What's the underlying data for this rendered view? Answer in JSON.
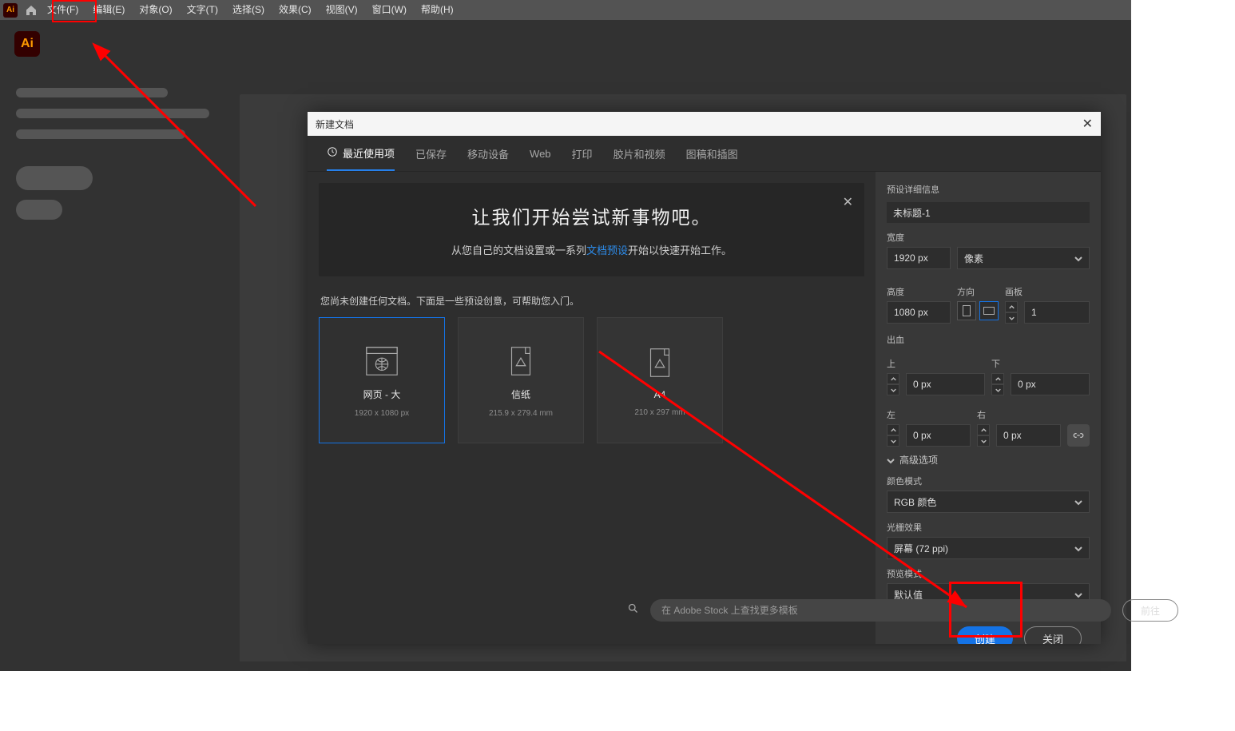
{
  "menu": {
    "file": "文件(F)",
    "edit": "编辑(E)",
    "object": "对象(O)",
    "type": "文字(T)",
    "select": "选择(S)",
    "effect": "效果(C)",
    "view": "视图(V)",
    "window": "窗口(W)",
    "help": "帮助(H)"
  },
  "app_mark": "Ai",
  "dialog": {
    "title": "新建文档",
    "tabs": {
      "recent": "最近使用项",
      "saved": "已保存",
      "mobile": "移动设备",
      "web": "Web",
      "print": "打印",
      "film": "胶片和视频",
      "art": "图稿和插图"
    },
    "hero": {
      "heading": "让我们开始尝试新事物吧。",
      "p_before": "从您自己的文档设置或一系列",
      "p_link": "文档预设",
      "p_after": "开始以快速开始工作。"
    },
    "hint": "您尚未创建任何文档。下面是一些预设创意，可帮助您入门。",
    "presets": [
      {
        "name": "网页 - 大",
        "dims": "1920 x 1080 px"
      },
      {
        "name": "信纸",
        "dims": "215.9 x 279.4 mm"
      },
      {
        "name": "A4",
        "dims": "210 x 297 mm"
      }
    ],
    "search": {
      "placeholder": "在 Adobe Stock 上查找更多模板",
      "go": "前往"
    },
    "side": {
      "title": "预设详细信息",
      "docname": "未标题-1",
      "labels": {
        "width": "宽度",
        "height": "高度",
        "orient": "方向",
        "artboards": "画板",
        "bleed": "出血",
        "top": "上",
        "bottom": "下",
        "left": "左",
        "right": "右",
        "adv": "高级选项",
        "cmode": "颜色模式",
        "raster": "光栅效果",
        "preview": "预览模式"
      },
      "width": "1920 px",
      "height": "1080 px",
      "unit": "像素",
      "artboards": "1",
      "bleed": {
        "top": "0 px",
        "bottom": "0 px",
        "left": "0 px",
        "right": "0 px"
      },
      "cmode": "RGB 颜色",
      "raster": "屏幕 (72 ppi)",
      "preview": "默认值"
    },
    "buttons": {
      "create": "创建",
      "close": "关闭"
    }
  }
}
